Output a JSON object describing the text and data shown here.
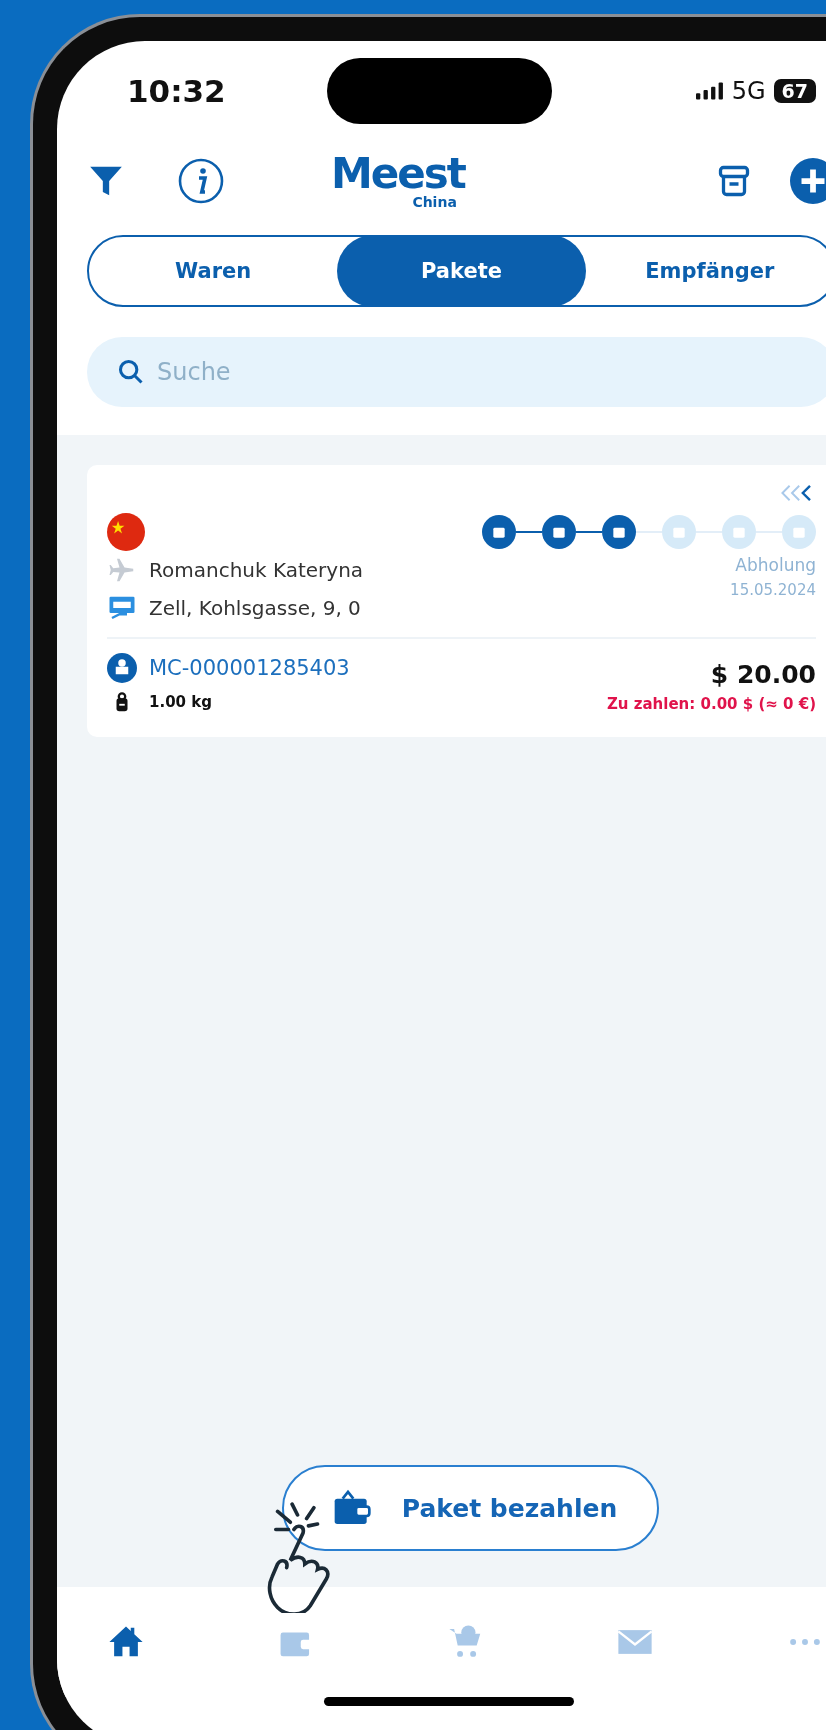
{
  "status_bar": {
    "time": "10:32",
    "network": "5G",
    "battery": "67"
  },
  "header": {
    "logo": "Meest",
    "logo_sub": "China"
  },
  "tabs": [
    {
      "label": "Waren",
      "selected": false
    },
    {
      "label": "Pakete",
      "selected": true
    },
    {
      "label": "Empfänger",
      "selected": false
    }
  ],
  "search": {
    "placeholder": "Suche"
  },
  "parcel": {
    "steps": [
      {
        "done": true
      },
      {
        "done": true
      },
      {
        "done": true
      },
      {
        "done": false
      },
      {
        "done": false
      },
      {
        "done": false
      }
    ],
    "recipient": "Romanchuk Kateryna",
    "address": "Zell, Kohlsgasse, 9, 0",
    "status": "Abholung",
    "date": "15.05.2024",
    "tracking": "MC-000001285403",
    "weight": "1.00 kg",
    "price": "$ 20.00",
    "due": "Zu zahlen: 0.00 $ (≈ 0 €)"
  },
  "pay_button": "Paket bezahlen",
  "nav": [
    {
      "kind": "home",
      "selected": true
    },
    {
      "kind": "wallet",
      "selected": false
    },
    {
      "kind": "cart",
      "selected": false
    },
    {
      "kind": "mail",
      "selected": false
    },
    {
      "kind": "more",
      "selected": false
    }
  ]
}
